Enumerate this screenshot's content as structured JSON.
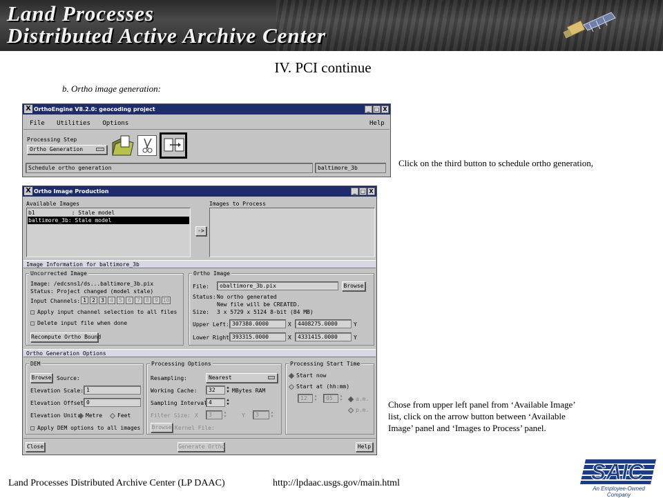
{
  "banner": {
    "line1": "Land Processes",
    "line2": "Distributed Active Archive Center"
  },
  "slide": {
    "title": "IV. PCI continue",
    "subtitle": "b. Ortho image generation:",
    "note1": "Click on the third button to schedule ortho generation,",
    "note2_lines": [
      "Chose from upper left panel from ‘Available Image’",
      "list, click on the arrow button between ‘Available",
      "Image’ panel and ‘Images to Process’ panel."
    ],
    "footer": "Land Processes Distributed Archive Center (LP DAAC)",
    "footer_url": "http://lpdaac.usgs.gov/main.html",
    "logo_text": "SAIC",
    "logo_tagline": "An Employee-Owned Company"
  },
  "orthoengine": {
    "title": "OrthoEngine V8.2.0: geocoding project",
    "title_buttons": [
      "_",
      "□",
      "X"
    ],
    "menu": [
      "File",
      "Utilities",
      "Options"
    ],
    "help": "Help",
    "processing_step_label": "Processing Step",
    "processing_step_value": "Ortho Generation",
    "status_text": "Schedule ortho generation",
    "project_name": "baltimore_3b"
  },
  "ortho_production": {
    "title": "Ortho Image Production",
    "title_buttons": [
      "_",
      "□",
      "X"
    ],
    "available_images_label": "Available Images",
    "images_to_process_label": "Images to Process",
    "available_images": [
      {
        "text": "b1           : Stale model",
        "selected": false
      },
      {
        "text": "baltimore_3b: Stale model",
        "selected": true
      }
    ],
    "arrow_button": "->",
    "image_info_header": "Image Information for baltimore_3b",
    "uncorrected": {
      "group_label": "Uncorrected Image",
      "image_line": "Image:  /edcsns1/ds...baltimore_3b.pix",
      "status_line": "Status: Project changed (model stale)",
      "input_channels_label": "Input Channels:",
      "channels": [
        "1",
        "2",
        "3",
        "4",
        "5",
        "6",
        "7",
        "8",
        "9",
        "10"
      ],
      "channels_active": 3,
      "apply_channel_sel": "Apply input channel selection to all files",
      "delete_input": "Delete input file when done",
      "recompute_button": "Recompute Ortho Bound"
    },
    "ortho_image": {
      "group_label": "Ortho Image",
      "file_label": "File:",
      "file_value": "obaltimore_3b.pix",
      "browse": "Browse",
      "status_label": "Status:",
      "status_1": "No ortho generated",
      "status_2": "New file will be CREATED.",
      "size_label": "Size:",
      "size_value": "3 x 5729 x 5124 8-bit (84 MB)",
      "upper_left_label": "Upper Left:",
      "upper_left_x": "307380.0000",
      "upper_left_y": "4408275.0000",
      "lower_right_label": "Lower Right:",
      "lower_right_x": "393315.0000",
      "lower_right_y": "4331415.0000",
      "x": "X",
      "y": "Y"
    },
    "gen_options_header": "Ortho Generation Options",
    "dem": {
      "group_label": "DEM",
      "browse": "Browse",
      "source_label": "Source:",
      "elev_scale_label": "Elevation Scale:",
      "elev_scale_value": "1",
      "elev_offset_label": "Elevation Offset:",
      "elev_offset_value": "0",
      "elev_unit_label": "Elevation Unit:",
      "metre": "Metre",
      "feet": "Feet",
      "apply_dem": "Apply DEM options to all images"
    },
    "processing": {
      "group_label": "Processing Options",
      "resampling_label": "Resampling:",
      "resampling_value": "Nearest",
      "cache_label": "Working Cache:",
      "cache_value": "32",
      "cache_unit": "MBytes RAM",
      "interval_label": "Sampling Interval:",
      "interval_value": "4",
      "filter_label": "Filter Size:",
      "filter_x": "X",
      "filter_x_value": "3",
      "filter_y": "Y",
      "filter_y_value": "3",
      "browse": "Browse",
      "kernel_label": "Kernel File:"
    },
    "start_time": {
      "group_label": "Processing Start Time",
      "start_now": "Start now",
      "start_at": "Start at (hh:mm)",
      "hh": "12",
      "mm": "05",
      "am": "a.m.",
      "pm": "p.m."
    },
    "close": "Close",
    "generate": "Generate Ortho",
    "help": "Help"
  }
}
